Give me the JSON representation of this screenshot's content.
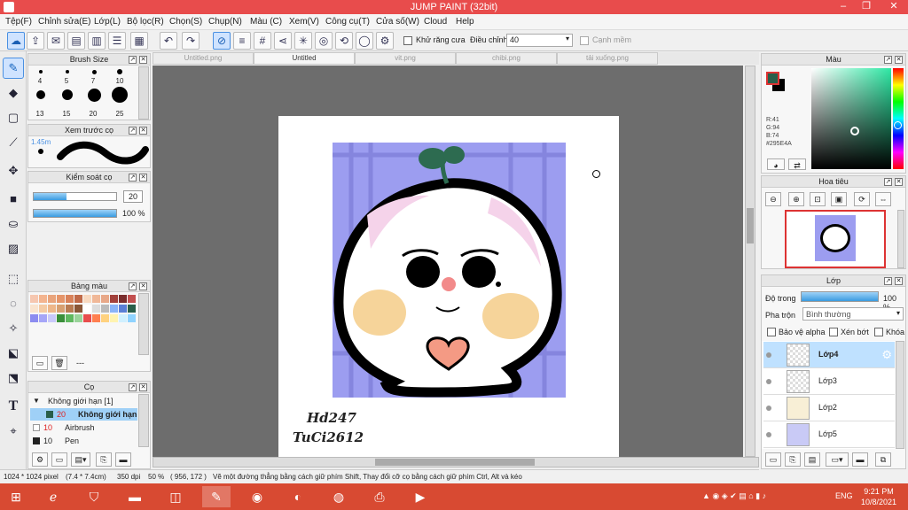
{
  "app": {
    "title": "JUMP PAINT (32bit)"
  },
  "window": {
    "min": "‒",
    "max": "❐",
    "close": "✕"
  },
  "menu": [
    "Tệp(F)",
    "Chỉnh sửa(E)",
    "Lớp(L)",
    "Bộ lọc(R)",
    "Chọn(S)",
    "Chụp(N)",
    "Màu (C)",
    "Xem(V)",
    "Công cụ(T)",
    "Cửa số(W)",
    "Cloud",
    "Help"
  ],
  "toolbar": {
    "antialias_label": "Khử răng cưa",
    "adjust_label": "Điều chỉnh",
    "adjust_value": "40",
    "snap_label": "Cạnh mềm"
  },
  "brush_size": {
    "title": "Brush Size",
    "sizes": [
      "4",
      "5",
      "7",
      "10",
      "13",
      "15",
      "20",
      "25"
    ]
  },
  "preview": {
    "title": "Xem trước cọ",
    "size": "1.45m"
  },
  "control": {
    "title": "Kiểm soát cọ",
    "size_value": "20",
    "opacity_value": "100 %"
  },
  "palette": {
    "title": "Bảng màu",
    "footer": "---"
  },
  "brush": {
    "title": "Cọ",
    "group": "Không giới hạn [1]",
    "items": [
      {
        "size": "20",
        "name": "Không giới hạn"
      },
      {
        "size": "10",
        "name": "Airbrush"
      },
      {
        "size": "10",
        "name": "Pen"
      }
    ]
  },
  "tabs": [
    "Untitled.png",
    "Untitled",
    "vit.png",
    "chibi.png",
    "tải xuống.png"
  ],
  "canvas": {
    "handwriting_line1": "Hd247",
    "handwriting_line2": "TuCi2612"
  },
  "status": {
    "size": "1024 * 1024 pixel",
    "cm": "(7.4 * 7.4cm)",
    "dpi": "350 dpi",
    "zoom": "50 %",
    "coords": "( 956, 172 )",
    "hint": "Vẽ một đường thẳng bằng cách giữ phím Shift, Thay đổi cỡ cọ bằng cách giữ phím Ctrl, Alt và kéo"
  },
  "color_panel": {
    "title": "Màu",
    "r": "R:41",
    "g": "G:94",
    "b": "B:74",
    "hex": "#295E4A",
    "primary": "#295E4A"
  },
  "navigator": {
    "title": "Hoa tiêu"
  },
  "layers_panel": {
    "title": "Lớp",
    "opacity_label": "Độ trong",
    "opacity_value": "100 %",
    "blend_label": "Pha trộn",
    "blend_value": "Bình thường",
    "alpha_label": "Bảo vệ alpha",
    "clip_label": "Xén bớt",
    "lock_label": "Khóa",
    "layers": [
      "Lớp4",
      "Lớp3",
      "Lớp2",
      "Lớp5"
    ]
  },
  "taskbar": {
    "time": "9:21 PM",
    "date": "10/8/2021",
    "lang": "ENG"
  }
}
